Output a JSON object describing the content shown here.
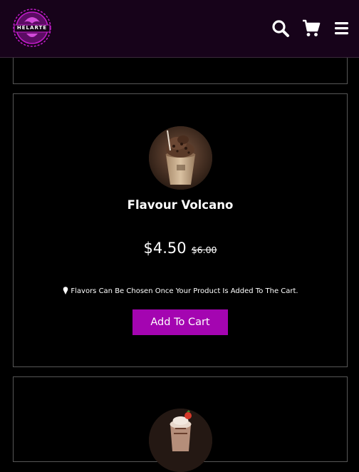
{
  "header": {
    "logo_text": "HELARTE",
    "icons": [
      "search-icon",
      "cart-icon",
      "menu-icon"
    ]
  },
  "product": {
    "title": "Flavour Volcano",
    "price": "$4.50",
    "old_price": "$6.00",
    "note": "Flavors Can Be Chosen Once Your Product Is Added To The Cart.",
    "add_to_cart_label": "Add To Cart"
  },
  "colors": {
    "header_bg": "#17031a",
    "accent": "#a405b1",
    "logo": "#c01cc8",
    "background": "#000000",
    "card_border": "#575757"
  }
}
